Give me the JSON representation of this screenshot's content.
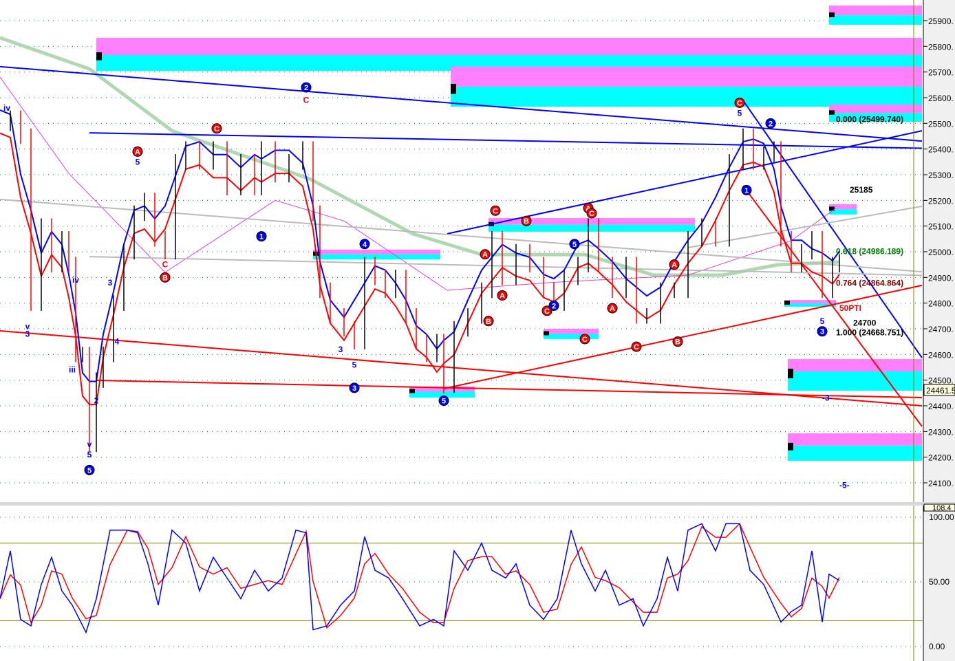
{
  "chart_data": {
    "type": "line",
    "title": "",
    "price_axis": {
      "ticks": [
        25900,
        25800,
        25700,
        25600,
        25500,
        25400,
        25300,
        25200,
        25100,
        25000,
        24900,
        24800,
        24700,
        24600,
        24500,
        24400,
        24300,
        24200,
        24100
      ],
      "ylim": [
        24100,
        25900
      ],
      "current_price": "24461.5"
    },
    "osc_axis": {
      "labels": [
        "108.4",
        "100.00",
        "50.00",
        "0.00"
      ],
      "ticks": [
        100,
        50,
        0
      ],
      "bands": [
        80,
        20
      ],
      "ylim": [
        0,
        100
      ]
    },
    "price_series": [
      [
        0,
        25500
      ],
      [
        3,
        25520
      ],
      [
        6,
        25450
      ],
      [
        9,
        24800
      ],
      [
        12,
        25100
      ],
      [
        15,
        24950
      ],
      [
        18,
        25050
      ],
      [
        20,
        24950
      ],
      [
        22,
        24600
      ],
      [
        24,
        24600
      ],
      [
        26,
        24250
      ],
      [
        28,
        24500
      ],
      [
        30,
        24600
      ],
      [
        33,
        24800
      ],
      [
        36,
        25000
      ],
      [
        39,
        25150
      ],
      [
        42,
        25200
      ],
      [
        45,
        25050
      ],
      [
        48,
        25000
      ],
      [
        51,
        25350
      ],
      [
        54,
        25400
      ],
      [
        58,
        25350
      ],
      [
        62,
        25400
      ],
      [
        66,
        25250
      ],
      [
        70,
        25350
      ],
      [
        74,
        25250
      ],
      [
        76,
        25400
      ],
      [
        80,
        25300
      ],
      [
        84,
        25350
      ],
      [
        88,
        25400
      ],
      [
        91,
        25150
      ],
      [
        93,
        24850
      ],
      [
        96,
        24750
      ],
      [
        100,
        24700
      ],
      [
        103,
        24650
      ],
      [
        106,
        24950
      ],
      [
        109,
        24900
      ],
      [
        112,
        24850
      ],
      [
        115,
        24900
      ],
      [
        118,
        24750
      ],
      [
        121,
        24650
      ],
      [
        124,
        24600
      ],
      [
        127,
        24650
      ],
      [
        129,
        24480
      ],
      [
        132,
        24700
      ],
      [
        136,
        24750
      ],
      [
        140,
        24850
      ],
      [
        143,
        25050
      ],
      [
        146,
        24900
      ],
      [
        150,
        25000
      ],
      [
        154,
        24950
      ],
      [
        158,
        24850
      ],
      [
        161,
        24800
      ],
      [
        164,
        24900
      ],
      [
        168,
        24950
      ],
      [
        171,
        25100
      ],
      [
        174,
        24950
      ],
      [
        178,
        24850
      ],
      [
        182,
        24950
      ],
      [
        185,
        24750
      ],
      [
        188,
        24750
      ],
      [
        192,
        24850
      ],
      [
        196,
        24850
      ],
      [
        200,
        25050
      ],
      [
        204,
        25100
      ],
      [
        208,
        25050
      ],
      [
        212,
        25350
      ],
      [
        216,
        25450
      ],
      [
        219,
        25350
      ],
      [
        222,
        25380
      ],
      [
        225,
        25400
      ],
      [
        227,
        25050
      ],
      [
        230,
        24950
      ],
      [
        233,
        25000
      ],
      [
        236,
        25050
      ],
      [
        239,
        24850
      ],
      [
        242,
        24950
      ],
      [
        244,
        24960
      ]
    ],
    "oscillator": [
      [
        0,
        37
      ],
      [
        3,
        74
      ],
      [
        6,
        21
      ],
      [
        9,
        16
      ],
      [
        12,
        48
      ],
      [
        15,
        69
      ],
      [
        18,
        43
      ],
      [
        21,
        32
      ],
      [
        25,
        11
      ],
      [
        28,
        37
      ],
      [
        32,
        90
      ],
      [
        37,
        90
      ],
      [
        40,
        88
      ],
      [
        43,
        64
      ],
      [
        46,
        32
      ],
      [
        50,
        90
      ],
      [
        54,
        80
      ],
      [
        58,
        43
      ],
      [
        62,
        69
      ],
      [
        66,
        53
      ],
      [
        70,
        37
      ],
      [
        74,
        59
      ],
      [
        78,
        43
      ],
      [
        82,
        53
      ],
      [
        86,
        90
      ],
      [
        89,
        88
      ],
      [
        91,
        13
      ],
      [
        95,
        16
      ],
      [
        99,
        32
      ],
      [
        103,
        43
      ],
      [
        106,
        85
      ],
      [
        109,
        59
      ],
      [
        113,
        53
      ],
      [
        117,
        37
      ],
      [
        122,
        16
      ],
      [
        126,
        21
      ],
      [
        129,
        16
      ],
      [
        132,
        74
      ],
      [
        136,
        59
      ],
      [
        140,
        80
      ],
      [
        143,
        59
      ],
      [
        147,
        53
      ],
      [
        150,
        64
      ],
      [
        154,
        32
      ],
      [
        158,
        21
      ],
      [
        162,
        37
      ],
      [
        166,
        90
      ],
      [
        169,
        64
      ],
      [
        173,
        43
      ],
      [
        176,
        59
      ],
      [
        180,
        32
      ],
      [
        184,
        37
      ],
      [
        187,
        16
      ],
      [
        191,
        37
      ],
      [
        194,
        69
      ],
      [
        197,
        43
      ],
      [
        200,
        90
      ],
      [
        204,
        95
      ],
      [
        208,
        74
      ],
      [
        211,
        95
      ],
      [
        215,
        95
      ],
      [
        218,
        59
      ],
      [
        222,
        48
      ],
      [
        227,
        19
      ],
      [
        230,
        27
      ],
      [
        233,
        32
      ],
      [
        236,
        74
      ],
      [
        239,
        19
      ],
      [
        241,
        56
      ],
      [
        244,
        51
      ]
    ],
    "ma_slow": [
      [
        0,
        25833
      ],
      [
        26,
        25712
      ],
      [
        50,
        25471
      ],
      [
        90,
        25284
      ],
      [
        120,
        25070
      ],
      [
        140,
        24989
      ],
      [
        170,
        24989
      ],
      [
        190,
        24909
      ],
      [
        210,
        24909
      ],
      [
        226,
        24949
      ],
      [
        244,
        24960
      ]
    ],
    "ma_magenta": [
      [
        0,
        25680
      ],
      [
        20,
        25305
      ],
      [
        48,
        24920
      ],
      [
        80,
        25200
      ],
      [
        100,
        25120
      ],
      [
        130,
        24850
      ],
      [
        160,
        24880
      ],
      [
        200,
        24909
      ],
      [
        230,
        25043
      ],
      [
        243,
        25170
      ]
    ],
    "trendlines": [
      {
        "color": "#0000ff",
        "points": [
          0,
          25721,
          268,
          25431
        ]
      },
      {
        "color": "#0000ff",
        "points": [
          26,
          25463,
          268,
          25403
        ]
      },
      {
        "color": "#0000ff",
        "points": [
          130,
          25070,
          268,
          25471
        ]
      },
      {
        "color": "#0000ff",
        "points": [
          216,
          25589,
          268,
          24587
        ]
      },
      {
        "color": "#ff0000",
        "points": [
          0,
          24692,
          268,
          24400
        ]
      },
      {
        "color": "#ff0000",
        "points": [
          28,
          24499,
          268,
          24432
        ]
      },
      {
        "color": "#ff0000",
        "points": [
          129,
          24467,
          268,
          24869
        ]
      },
      {
        "color": "#ff0000",
        "points": [
          216,
          25257,
          268,
          24320
        ]
      },
      {
        "color": "#bbbbbb",
        "points": [
          0,
          25204,
          268,
          24922
        ]
      },
      {
        "color": "#bbbbbb",
        "points": [
          26,
          24981,
          268,
          24908
        ]
      },
      {
        "color": "#bbbbbb",
        "points": [
          200,
          25016,
          268,
          25177
        ]
      }
    ],
    "zones": [
      {
        "b0": 241,
        "b1": 268,
        "top": 25959,
        "mid": 25921,
        "bottom": 25884
      },
      {
        "b0": 28,
        "b1": 268,
        "top": 25833,
        "mid": 25766,
        "bottom": 25704
      },
      {
        "b0": 131,
        "b1": 268,
        "top": 25721,
        "mid": 25643,
        "bottom": 25565
      },
      {
        "b0": 241,
        "b1": 268,
        "top": 25573,
        "mid": 25540,
        "bottom": 25506
      },
      {
        "b0": 91,
        "b1": 128,
        "top": 25008,
        "mid": 24990,
        "bottom": 24970
      },
      {
        "b0": 142,
        "b1": 202,
        "top": 25131,
        "mid": 25105,
        "bottom": 25078
      },
      {
        "b0": 158,
        "b1": 174,
        "top": 24700,
        "mid": 24680,
        "bottom": 24660
      },
      {
        "b0": 119,
        "b1": 138,
        "top": 24475,
        "mid": 24455,
        "bottom": 24432
      },
      {
        "b0": 241,
        "b1": 249,
        "top": 25185,
        "mid": 25165,
        "bottom": 25145
      },
      {
        "b0": 228,
        "b1": 243,
        "top": 24812,
        "mid": 24799,
        "bottom": 24786
      },
      {
        "b0": 229,
        "b1": 268,
        "top": 24582,
        "mid": 24534,
        "bottom": 24459
      },
      {
        "b0": 229,
        "b1": 268,
        "top": 24293,
        "mid": 24245,
        "bottom": 24186
      }
    ],
    "annotations": [
      {
        "text": "25185",
        "bar": 247,
        "price": 25230,
        "color": "#000000"
      },
      {
        "text": "0.000 (25499.740)",
        "bar": 243,
        "price": 25505,
        "color": "#000000"
      },
      {
        "text": "0.618 (24986.189)",
        "bar": 243,
        "price": 24990,
        "color": "#008000"
      },
      {
        "text": "0.764 (24864.864)",
        "bar": 243,
        "price": 24868,
        "color": "#800000"
      },
      {
        "text": "24700",
        "bar": 248,
        "price": 24712,
        "color": "#000000"
      },
      {
        "text": "1.000 (24668.751)",
        "bar": 243,
        "price": 24674,
        "color": "#000000"
      },
      {
        "text": "50PTI",
        "bar": 244,
        "price": 24770,
        "color": "#ff0000"
      },
      {
        "text": "-3-",
        "bar": 239,
        "price": 24420,
        "color": "#0000ff"
      },
      {
        "text": "-5-",
        "bar": 244,
        "price": 24080,
        "color": "#0000ff"
      }
    ],
    "wave_labels": [
      {
        "text": "iv",
        "bar": 2,
        "price": 25560,
        "style": "blue"
      },
      {
        "text": "v",
        "bar": 8,
        "price": 24710,
        "style": "blue"
      },
      {
        "text": "3",
        "bar": 8,
        "price": 24680,
        "style": "blue"
      },
      {
        "text": "iii",
        "bar": 21,
        "price": 24540,
        "style": "blue"
      },
      {
        "text": "iv",
        "bar": 22,
        "price": 24890,
        "style": "blue"
      },
      {
        "text": "v",
        "bar": 26,
        "price": 24250,
        "style": "blue"
      },
      {
        "text": "5",
        "bar": 26,
        "price": 24210,
        "style": "blue"
      },
      {
        "text": "5",
        "bar": 26,
        "price": 24150,
        "style": "circle-blue"
      },
      {
        "text": "2",
        "bar": 28,
        "price": 24420,
        "style": "blue"
      },
      {
        "text": "3",
        "bar": 32,
        "price": 24880,
        "style": "blue"
      },
      {
        "text": "4",
        "bar": 34,
        "price": 24650,
        "style": "blue"
      },
      {
        "text": "A",
        "bar": 40,
        "price": 25390,
        "style": "circle-red"
      },
      {
        "text": "5",
        "bar": 40,
        "price": 25350,
        "style": "blue"
      },
      {
        "text": "C",
        "bar": 48,
        "price": 24950,
        "style": "red"
      },
      {
        "text": "B",
        "bar": 48,
        "price": 24900,
        "style": "circle-red"
      },
      {
        "text": "C",
        "bar": 63,
        "price": 25480,
        "style": "circle-red"
      },
      {
        "text": "1",
        "bar": 76,
        "price": 25060,
        "style": "circle-blue"
      },
      {
        "text": "2",
        "bar": 89,
        "price": 25640,
        "style": "circle-blue"
      },
      {
        "text": "C",
        "bar": 89,
        "price": 25590,
        "style": "red"
      },
      {
        "text": "3",
        "bar": 99,
        "price": 24620,
        "style": "blue"
      },
      {
        "text": "5",
        "bar": 103,
        "price": 24560,
        "style": "blue"
      },
      {
        "text": "3",
        "bar": 103,
        "price": 24470,
        "style": "circle-blue"
      },
      {
        "text": "4",
        "bar": 106,
        "price": 25030,
        "style": "circle-blue"
      },
      {
        "text": "5",
        "bar": 129,
        "price": 24420,
        "style": "circle-blue"
      },
      {
        "text": "C",
        "bar": 144,
        "price": 25160,
        "style": "circle-red"
      },
      {
        "text": "B",
        "bar": 153,
        "price": 25120,
        "style": "circle-red"
      },
      {
        "text": "A",
        "bar": 141,
        "price": 24990,
        "style": "circle-red"
      },
      {
        "text": "B",
        "bar": 142,
        "price": 24730,
        "style": "circle-red"
      },
      {
        "text": "A",
        "bar": 146,
        "price": 24830,
        "style": "circle-red"
      },
      {
        "text": "C",
        "bar": 159,
        "price": 24770,
        "style": "circle-red"
      },
      {
        "text": "2",
        "bar": 161,
        "price": 24790,
        "style": "circle-blue"
      },
      {
        "text": "C",
        "bar": 170,
        "price": 24660,
        "style": "circle-red"
      },
      {
        "text": "5",
        "bar": 167,
        "price": 25030,
        "style": "circle-blue"
      },
      {
        "text": "A",
        "bar": 171,
        "price": 25170,
        "style": "circle-red"
      },
      {
        "text": "C",
        "bar": 172,
        "price": 25150,
        "style": "circle-red"
      },
      {
        "text": "A",
        "bar": 178,
        "price": 24780,
        "style": "circle-red"
      },
      {
        "text": "C",
        "bar": 185,
        "price": 24630,
        "style": "circle-red"
      },
      {
        "text": "B",
        "bar": 197,
        "price": 24650,
        "style": "circle-red"
      },
      {
        "text": "A",
        "bar": 196,
        "price": 24950,
        "style": "circle-red"
      },
      {
        "text": "5",
        "bar": 215,
        "price": 25540,
        "style": "blue"
      },
      {
        "text": "C",
        "bar": 215,
        "price": 25580,
        "style": "circle-red"
      },
      {
        "text": "2",
        "bar": 224,
        "price": 25500,
        "style": "circle-blue"
      },
      {
        "text": "1",
        "bar": 217,
        "price": 25240,
        "style": "circle-blue"
      },
      {
        "text": "3",
        "bar": 239,
        "price": 24690,
        "style": "circle-blue"
      },
      {
        "text": "5",
        "bar": 239,
        "price": 24730,
        "style": "blue"
      }
    ],
    "colors": {
      "upper_band": "#0000ff",
      "lower_band": "#ff0000",
      "osc_fast": "#0000ff",
      "osc_slow": "#ff0000",
      "grid": "#008080",
      "olive": "#808000"
    }
  }
}
